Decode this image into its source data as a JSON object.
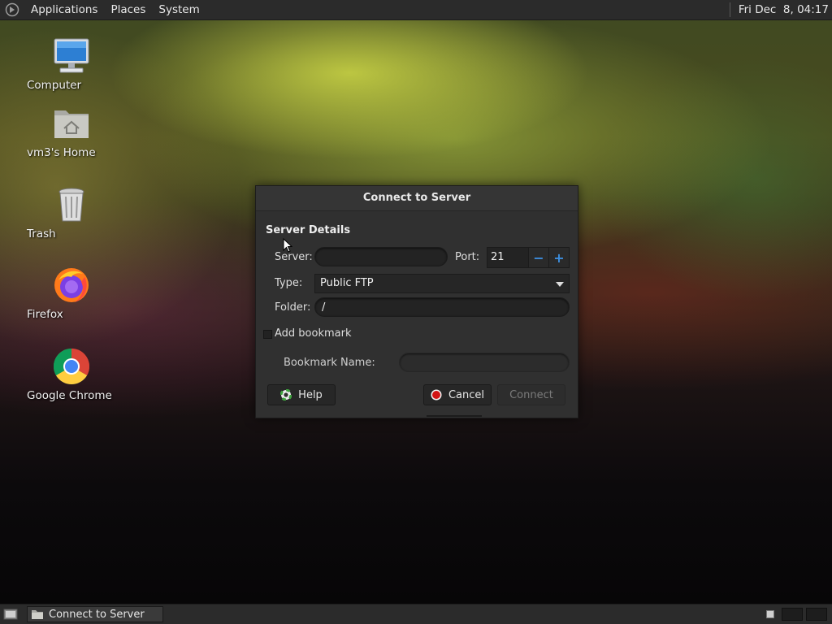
{
  "top_panel": {
    "menus": [
      "Applications",
      "Places",
      "System"
    ],
    "clock": "Fri Dec  8, 04:17"
  },
  "desktop": {
    "icons": [
      {
        "label": "Computer",
        "icon": "computer-icon"
      },
      {
        "label": "vm3's Home",
        "icon": "home-folder-icon"
      },
      {
        "label": "Trash",
        "icon": "trash-icon"
      },
      {
        "label": "Firefox",
        "icon": "firefox-icon"
      },
      {
        "label": "Google Chrome",
        "icon": "chrome-icon"
      }
    ]
  },
  "dialog": {
    "title": "Connect to Server",
    "section_title": "Server Details",
    "server_label": "Server:",
    "server_value": "",
    "port_label": "Port:",
    "port_value": "21",
    "type_label": "Type:",
    "type_value": "Public FTP",
    "folder_label": "Folder:",
    "folder_value": "/",
    "add_bookmark_label": "Add bookmark",
    "add_bookmark_checked": false,
    "bookmark_name_label": "Bookmark Name:",
    "bookmark_name_value": "",
    "help_label": "Help",
    "cancel_label": "Cancel",
    "connect_label": "Connect"
  },
  "taskbar": {
    "window_label": "Connect to Server"
  }
}
